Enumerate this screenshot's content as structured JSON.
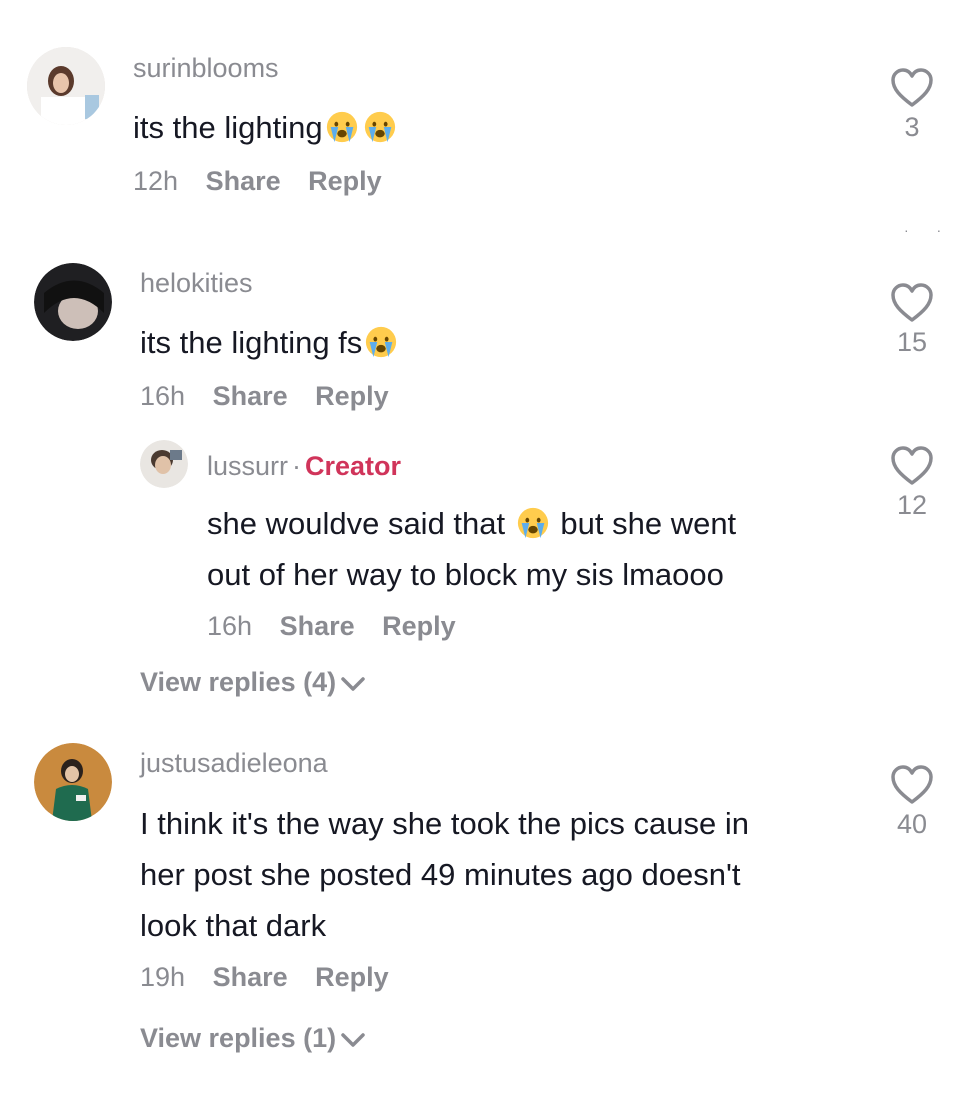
{
  "comments": [
    {
      "username": "surinblooms",
      "text": "its the lighting",
      "time": "12h",
      "share": "Share",
      "reply": "Reply",
      "likes": "3"
    },
    {
      "username": "helokities",
      "text": "its the lighting fs",
      "time": "16h",
      "share": "Share",
      "reply": "Reply",
      "likes": "15",
      "view_replies": "View replies (4)",
      "replies": [
        {
          "username": "lussurr",
          "separator": "·",
          "badge": "Creator",
          "text_line1_a": "she wouldve said that",
          "text_line1_b": "but she went",
          "text_line2": "out of her way to block my sis lmaooo",
          "time": "16h",
          "share": "Share",
          "reply": "Reply",
          "likes": "12"
        }
      ]
    },
    {
      "username": "justusadieleona",
      "text_lines": [
        "I think it's the way she took the pics cause in",
        "her post she posted 49 minutes ago doesn't",
        "look that dark"
      ],
      "time": "19h",
      "share": "Share",
      "reply": "Reply",
      "likes": "40",
      "view_replies": "View replies (1)"
    }
  ],
  "colors": {
    "username": "#8a8b91",
    "text": "#161823",
    "creator_badge": "#d0345a"
  },
  "icons": [
    "heart-outline-icon",
    "crying-face-emoji",
    "chevron-down-icon"
  ]
}
